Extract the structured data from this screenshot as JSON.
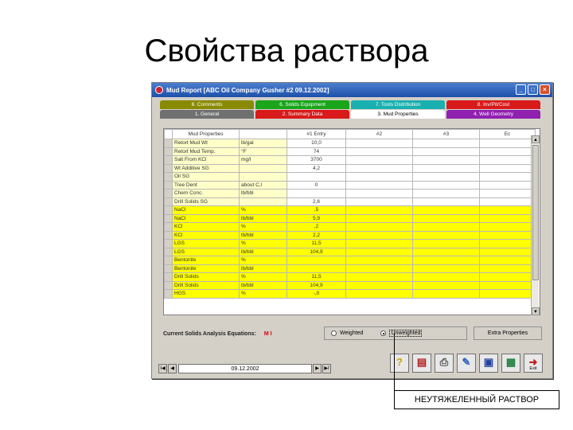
{
  "slide": {
    "title": "Свойства раствора"
  },
  "window": {
    "title": "Mud Report [ABC Oil Company Gusher #2 09.12.2002]"
  },
  "tabs_row1": [
    {
      "label": "6. Comments",
      "color": "#8a8a00"
    },
    {
      "label": "6. Solids Equipment",
      "color": "#1aa51a"
    },
    {
      "label": "7. Tools Distribution",
      "color": "#1ab0b0"
    },
    {
      "label": "8. Inv/Pit/Cost",
      "color": "#d81a1a"
    }
  ],
  "tabs_row2": [
    {
      "label": "1. General",
      "color": "#707070"
    },
    {
      "label": "2. Summary Data",
      "color": "#d81a1a"
    },
    {
      "label": "3. Mud Properties",
      "color": "#ffffff",
      "active": true
    },
    {
      "label": "4. Well Geometry",
      "color": "#9020b0"
    }
  ],
  "grid": {
    "headers": [
      "Mud Properties",
      "",
      "#1 Entry",
      "#2",
      "#3",
      "Ec"
    ],
    "rows": [
      {
        "name": "Retort Mud Wt",
        "unit": "lb/gal",
        "value": "10,0",
        "style": "pale"
      },
      {
        "name": "Retort Mud Temp.",
        "unit": "°F",
        "value": "74",
        "style": "pale"
      },
      {
        "name": "Salt From KCl",
        "unit": "mg/l",
        "value": "3700",
        "style": "pale"
      },
      {
        "name": "Wt Additive SG",
        "unit": "",
        "value": "4,2",
        "style": "pale"
      },
      {
        "name": "Oil SG",
        "unit": "",
        "value": "",
        "style": "pale"
      },
      {
        "name": "Tree Dent",
        "unit": "about C,l",
        "value": "0",
        "style": "pale"
      },
      {
        "name": "Chem Conc.",
        "unit": "lb/bbl",
        "value": "",
        "style": "pale"
      },
      {
        "name": "Drill Solids SG",
        "unit": "",
        "value": "2,6",
        "style": "pale"
      },
      {
        "name": "NaCl",
        "unit": "%",
        "value": ",5",
        "style": "yel"
      },
      {
        "name": "NaCl",
        "unit": "lb/bbl",
        "value": "5,9",
        "style": "yel"
      },
      {
        "name": "KCl",
        "unit": "%",
        "value": ",2",
        "style": "yel"
      },
      {
        "name": "KCl",
        "unit": "lb/bbl",
        "value": "2,2",
        "style": "yel"
      },
      {
        "name": "LGS",
        "unit": "%",
        "value": "11,5",
        "style": "yel"
      },
      {
        "name": "LGS",
        "unit": "lb/bbl",
        "value": "104,9",
        "style": "yel"
      },
      {
        "name": "Bentonite",
        "unit": "%",
        "value": "",
        "style": "yel"
      },
      {
        "name": "Bentonite",
        "unit": "lb/bbl",
        "value": "",
        "style": "yel"
      },
      {
        "name": "Drill Solids",
        "unit": "%",
        "value": "11,5",
        "style": "yel"
      },
      {
        "name": "Drill Solids",
        "unit": "lb/bbl",
        "value": "104,9",
        "style": "yel"
      },
      {
        "name": "HGS",
        "unit": "%",
        "value": "-,0",
        "style": "yel"
      }
    ]
  },
  "solids": {
    "label": "Current Solids Analysis Equations:",
    "value": "M I",
    "options": [
      "Weighted",
      "Unweighted"
    ],
    "selected": "Unweighted",
    "extra_button": "Extra Properties"
  },
  "nav": {
    "date": "09.12.2002",
    "first": "I◀",
    "prev": "◀",
    "next": "▶",
    "last": "▶I"
  },
  "toolbar_buttons": [
    {
      "icon": "help-icon",
      "label": ""
    },
    {
      "icon": "report-icon",
      "label": ""
    },
    {
      "icon": "print-icon",
      "label": ""
    },
    {
      "icon": "tools-icon",
      "label": ""
    },
    {
      "icon": "save-icon",
      "label": ""
    },
    {
      "icon": "grid-icon",
      "label": ""
    },
    {
      "icon": "exit-icon",
      "label": "Exit"
    }
  ],
  "callout": {
    "text": "НЕУТЯЖЕЛЕННЫЙ РАСТВОР"
  }
}
